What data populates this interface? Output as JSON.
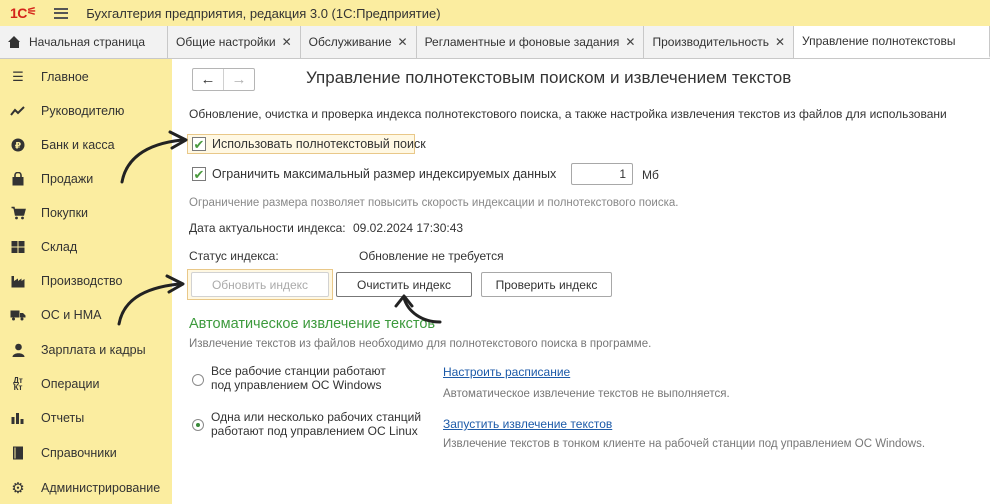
{
  "titlebar": {
    "logo": "1С",
    "title": "Бухгалтерия предприятия, редакция 3.0  (1С:Предприятие)"
  },
  "tabs": [
    {
      "label": "Начальная страница",
      "closable": false
    },
    {
      "label": "Общие настройки",
      "closable": true
    },
    {
      "label": "Обслуживание",
      "closable": true
    },
    {
      "label": "Регламентные и фоновые задания",
      "closable": true
    },
    {
      "label": "Производительность",
      "closable": true
    },
    {
      "label": "Управление полнотекстовы",
      "closable": false
    }
  ],
  "sidebar": {
    "items": [
      {
        "label": "Главное",
        "icon": "menu-icon"
      },
      {
        "label": "Руководителю",
        "icon": "trend-icon"
      },
      {
        "label": "Банк и касса",
        "icon": "ruble-icon"
      },
      {
        "label": "Продажи",
        "icon": "bag-icon"
      },
      {
        "label": "Покупки",
        "icon": "cart-icon"
      },
      {
        "label": "Склад",
        "icon": "warehouse-icon"
      },
      {
        "label": "Производство",
        "icon": "factory-icon"
      },
      {
        "label": "ОС и НМА",
        "icon": "truck-icon"
      },
      {
        "label": "Зарплата и кадры",
        "icon": "person-icon"
      },
      {
        "label": "Операции",
        "icon": "dt-kt-icon"
      },
      {
        "label": "Отчеты",
        "icon": "bar-chart-icon"
      },
      {
        "label": "Справочники",
        "icon": "book-icon"
      },
      {
        "label": "Администрирование",
        "icon": "gear-icon"
      }
    ]
  },
  "main": {
    "nav": {
      "back": "←",
      "forward": "→"
    },
    "title": "Управление полнотекстовым поиском и извлечением текстов",
    "description": "Обновление, очистка и проверка индекса полнотекстового поиска, а также настройка извлечения текстов из файлов для использовани",
    "use_fulltext": {
      "label": "Использовать полнотекстовый поиск",
      "checked": true
    },
    "limit_size": {
      "label": "Ограничить максимальный размер индексируемых данных",
      "checked": true,
      "value": "1",
      "unit": "Мб"
    },
    "limit_hint": "Ограничение размера позволяет повысить скорость индексации и полнотекстового поиска.",
    "index_date_label": "Дата актуальности индекса:",
    "index_date_value": "09.02.2024 17:30:43",
    "index_status_label": "Статус индекса:",
    "index_status_value": "Обновление не требуется",
    "buttons": {
      "update": "Обновить индекс",
      "clear": "Очистить индекс",
      "check": "Проверить индекс"
    },
    "extraction": {
      "title": "Автоматическое извлечение текстов",
      "description": "Извлечение текстов из файлов необходимо для полнотекстового поиска в программе.",
      "option_windows": {
        "line1": "Все рабочие станции работают",
        "line2": "под управлением ОС Windows",
        "selected": false,
        "link": "Настроить расписание",
        "note": "Автоматическое извлечение текстов не выполняется."
      },
      "option_linux": {
        "line1": "Одна или несколько рабочих станций",
        "line2": "работают под управлением ОС Linux",
        "selected": true,
        "link": "Запустить извлечение текстов",
        "note": "Извлечение текстов в тонком клиенте на рабочей станции под управлением ОС Windows."
      }
    }
  },
  "colors": {
    "sidebar_bg": "#fbeda0",
    "accent_green": "#3d9a3d",
    "link_blue": "#1c5aa8",
    "logo_red": "#d4231a"
  }
}
